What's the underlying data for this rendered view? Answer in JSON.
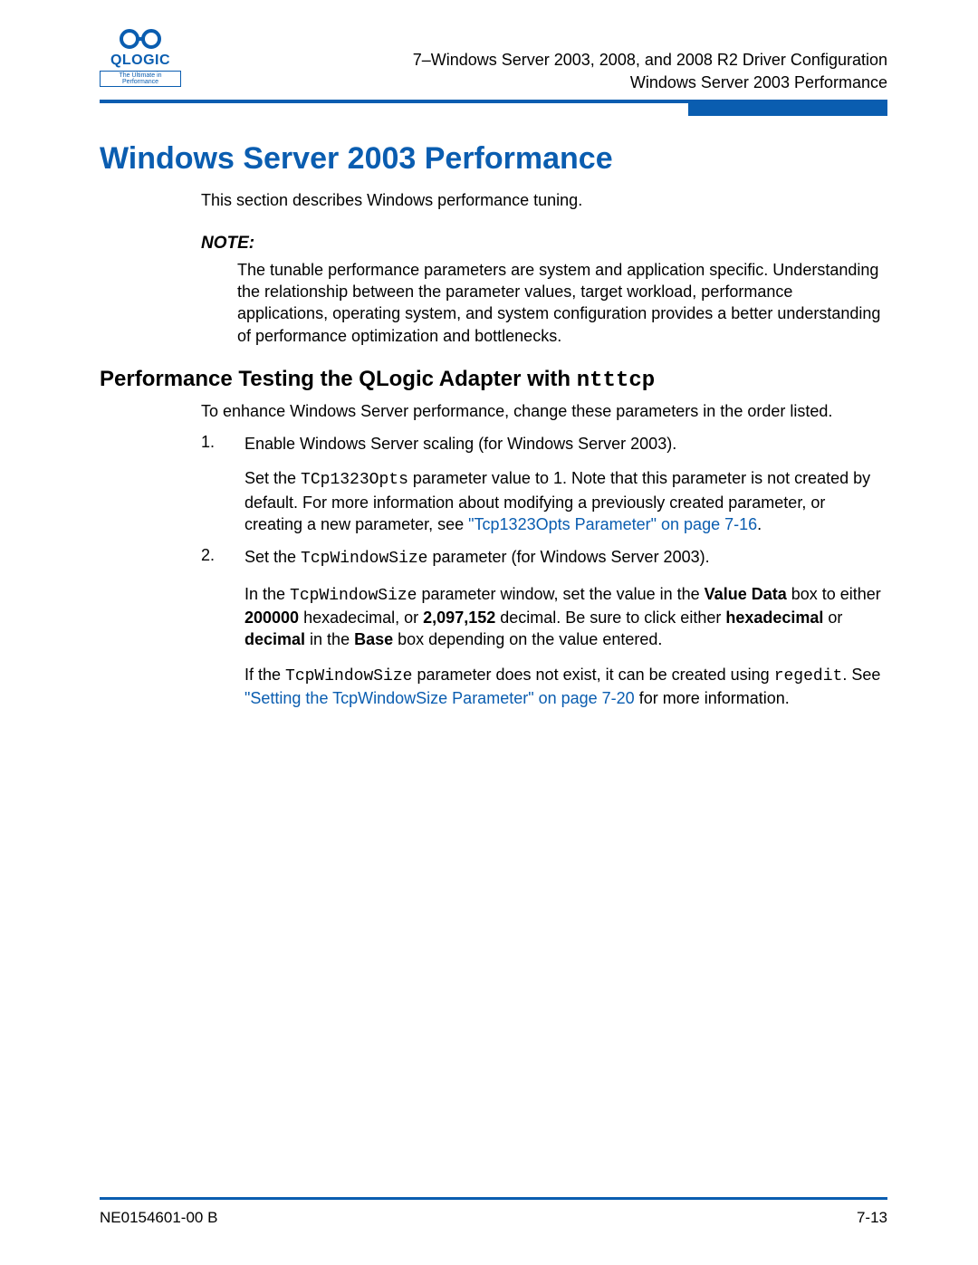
{
  "logo": {
    "brand": "QLOGIC",
    "tagline": "The Ultimate in Performance"
  },
  "header": {
    "line1": "7–Windows Server 2003, 2008, and 2008 R2 Driver Configuration",
    "line2": "Windows Server 2003 Performance"
  },
  "title": "Windows Server 2003 Performance",
  "intro": "This section describes Windows performance tuning.",
  "note": {
    "heading": "NOTE:",
    "body": "The tunable performance parameters are system and application specific. Understanding the relationship between the parameter values, target workload, performance applications, operating system, and system configuration provides a better understanding of performance optimization and bottlenecks."
  },
  "subhead": {
    "prefix": "Performance Testing the QLogic Adapter with ",
    "code": "ntttcp"
  },
  "subintro": "To enhance Windows Server performance, change these parameters in the order listed.",
  "steps": [
    {
      "num": "1.",
      "lead": "Enable Windows Server scaling (for Windows Server 2003).",
      "p1a": "Set the ",
      "p1code": "TCp1323Opts",
      "p1b": " parameter value to 1. Note that this parameter is not created by default. For more information about modifying a previously created parameter, or creating a new parameter, see ",
      "p1link": "\"Tcp1323Opts Parameter\" on page 7-16",
      "p1c": "."
    },
    {
      "num": "2.",
      "lead_a": "Set the ",
      "lead_code": "TcpWindowSize",
      "lead_b": " parameter (for Windows Server 2003).",
      "p1a": "In the ",
      "p1code": "TcpWindowSize",
      "p1b": " parameter window, set the value in the ",
      "p1bold1": "Value Data",
      "p1c": " box to either ",
      "p1bold2": "200000",
      "p1d": " hexadecimal, or ",
      "p1bold3": "2,097,152",
      "p1e": " decimal. Be sure to click either ",
      "p1bold4": "hexadecimal",
      "p1f": " or ",
      "p1bold5": "decimal",
      "p1g": " in the ",
      "p1bold6": "Base",
      "p1h": " box depending on the value entered.",
      "p2a": "If the ",
      "p2code1": "TcpWindowSize",
      "p2b": " parameter does not exist, it can be created using ",
      "p2code2": "regedit",
      "p2c": ". See ",
      "p2link": "\"Setting the TcpWindowSize Parameter\" on page 7-20",
      "p2d": " for more information."
    }
  ],
  "footer": {
    "left": "NE0154601-00 B",
    "right": "7-13"
  }
}
